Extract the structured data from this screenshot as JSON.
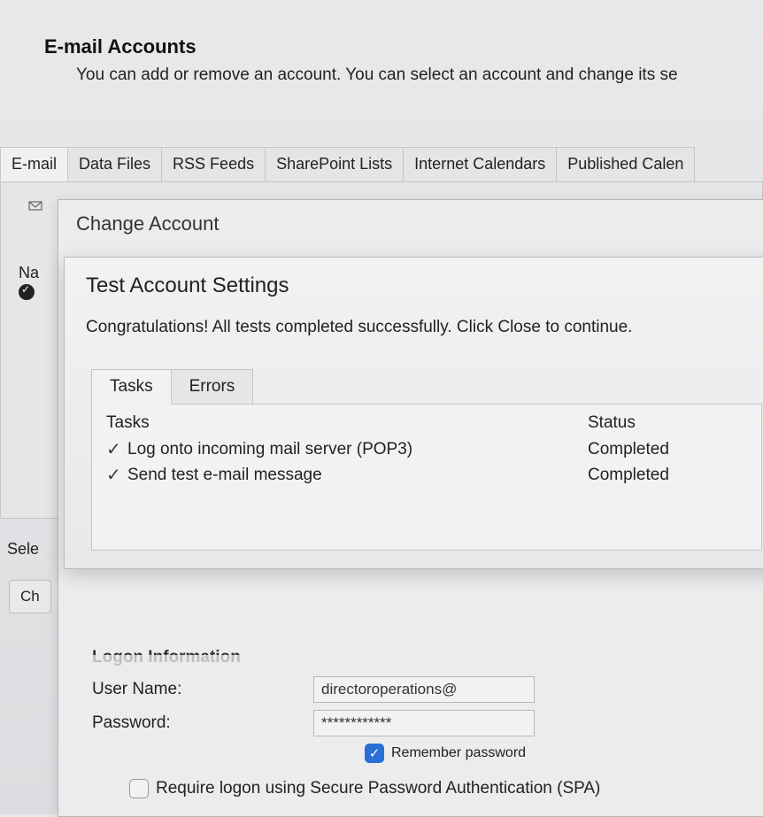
{
  "header": {
    "title": "E-mail Accounts",
    "subtitle": "You can add or remove an account. You can select an account and change its se"
  },
  "tabs": [
    "E-mail",
    "Data Files",
    "RSS Feeds",
    "SharePoint Lists",
    "Internet Calendars",
    "Published Calen"
  ],
  "tab_panel": {
    "name_col": "Na",
    "select_fragment": "Sele",
    "change_fragment": "Ch"
  },
  "change_dialog": {
    "title": "Change Account",
    "logon_heading": "Logon Information",
    "username_label": "User Name:",
    "username_value": "directoroperations@",
    "password_label": "Password:",
    "password_value": "************",
    "remember_label": "Remember password",
    "spa_label": "Require logon using Secure Password Authentication (SPA)"
  },
  "test_dialog": {
    "title": "Test Account Settings",
    "message": "Congratulations! All tests completed successfully. Click Close to continue.",
    "tabs": [
      "Tasks",
      "Errors"
    ],
    "col_task": "Tasks",
    "col_status": "Status",
    "rows": [
      {
        "name": "Log onto incoming mail server (POP3)",
        "status": "Completed"
      },
      {
        "name": "Send test e-mail message",
        "status": "Completed"
      }
    ]
  }
}
